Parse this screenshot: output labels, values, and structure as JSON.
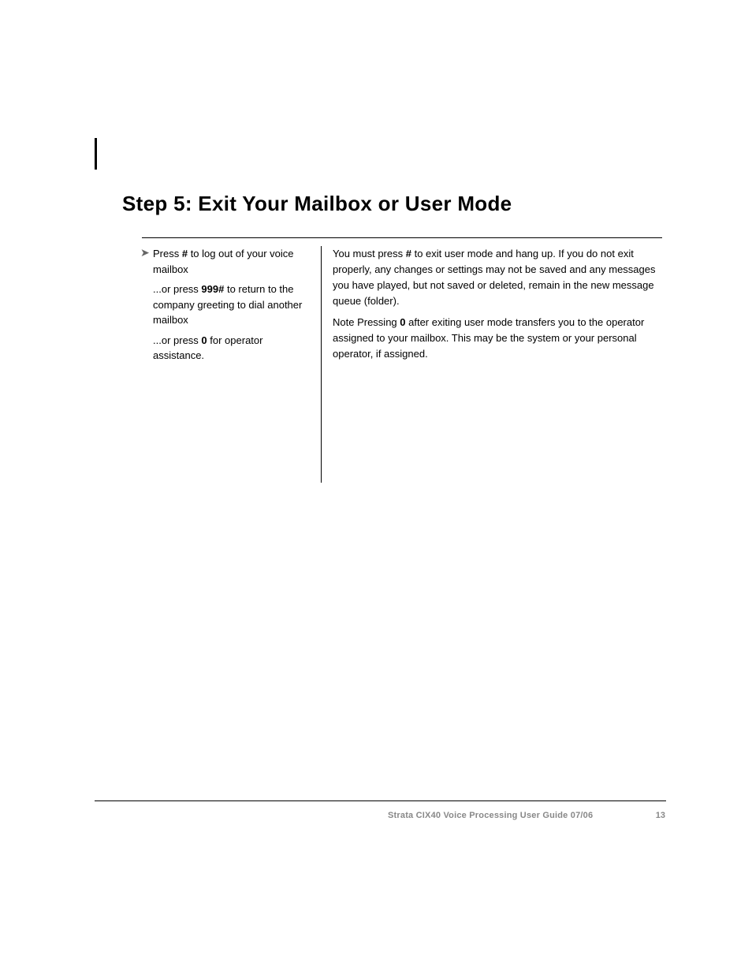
{
  "title": "Step 5:  Exit Your Mailbox or User Mode",
  "left_col": {
    "press": "Press ",
    "pound": "#",
    "to_log_out": " to log out of your voice mailbox",
    "or_press": "...or press ",
    "nine_nine_nine_pound": "999#",
    "to_return_company": " to return to the company greeting to dial another mailbox",
    "zero": "0",
    "for_operator": " for operator assistance."
  },
  "right_col": {
    "you_must_press": "You must press ",
    "pound": "#",
    "to_exit_user_mode": " to exit user mode and hang up. If you do not exit properly, any changes or settings may not be saved and any messages you have played, but not saved or deleted, remain in the new message queue (folder).",
    "note_label": "Note    ",
    "note_pressing": "Pressing ",
    "zero": "0",
    "note_rest": " after exiting user mode transfers you to the operator assigned to your mailbox. This may be the system or your personal operator, if assigned."
  },
  "footer": {
    "guide": "Strata CIX40 Voice Processing User Guide    07/06",
    "page": "13"
  }
}
